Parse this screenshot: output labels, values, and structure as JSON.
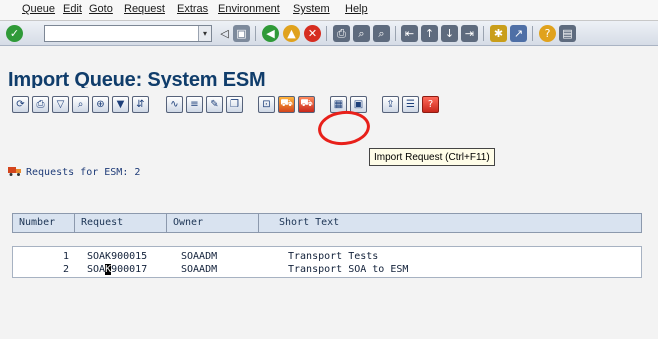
{
  "menu": {
    "items": [
      "Queue",
      "Edit",
      "Goto",
      "Request",
      "Extras",
      "Environment",
      "System",
      "Help"
    ]
  },
  "standard_toolbar": {
    "command_field_value": "",
    "icons": [
      "enter-icon",
      "save-icon",
      "back-icon",
      "exit-icon",
      "cancel-icon",
      "print-icon",
      "find-icon",
      "find-next-icon",
      "first-page-icon",
      "previous-page-icon",
      "next-page-icon",
      "last-page-icon",
      "create-session-icon",
      "shortcut-icon",
      "help-icon",
      "layout-icon"
    ]
  },
  "title": "Import Queue: System ESM",
  "app_toolbar": {
    "icons": [
      "refresh-icon",
      "print-icon",
      "filter-icon",
      "find-icon",
      "zoom-icon",
      "filter-set-icon",
      "transport-icon",
      "check-icon",
      "details-icon",
      "edit-icon",
      "copy-icon",
      "lock-icon",
      "import-all-icon",
      "import-request-icon",
      "overview-icon",
      "monitor-icon",
      "export-icon",
      "list-icon",
      "help-icon"
    ],
    "tooltip": "Import Request  (Ctrl+F11)"
  },
  "requests_label": "Requests for ESM:",
  "requests_count": "2",
  "table": {
    "columns": [
      "Number",
      "Request",
      "Owner",
      "Short Text"
    ],
    "rows": [
      {
        "number": "1",
        "request": "SOAK900015",
        "owner": "SOAADM",
        "short_text": "Transport Tests"
      },
      {
        "number": "2",
        "request_pre": "SOA",
        "request_cursor": "K",
        "request_post": "900017",
        "owner": "SOAADM",
        "short_text": "Transport SOA to ESM"
      }
    ]
  }
}
